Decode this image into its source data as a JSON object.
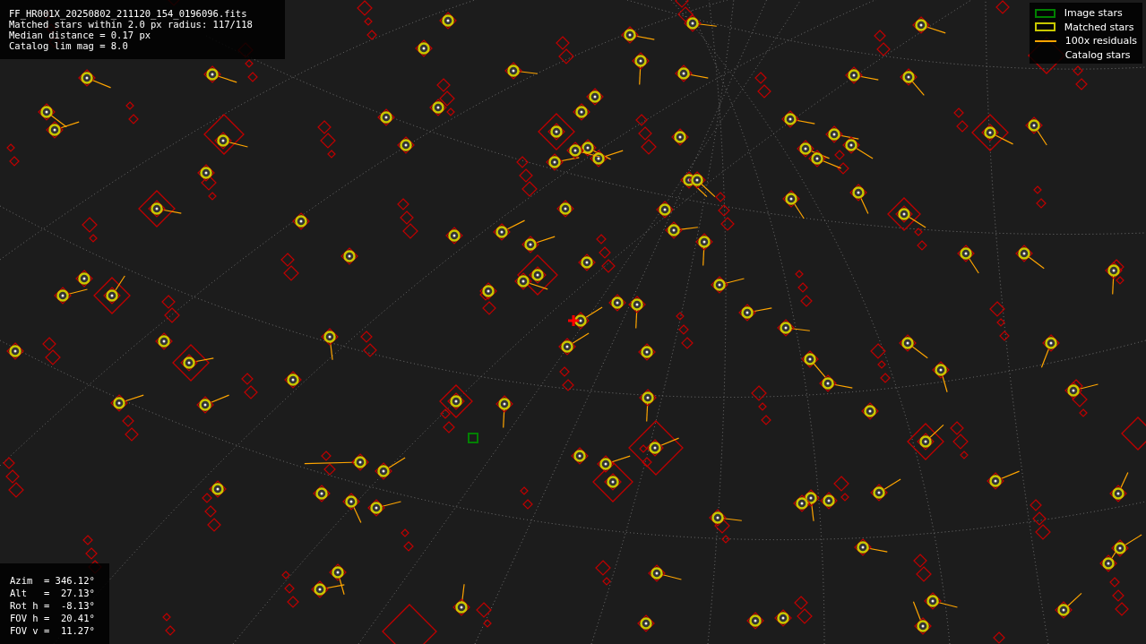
{
  "info": {
    "lines": [
      "FF_HR001X_20250802_211120_154_0196096.fits",
      "Matched stars within 2.0 px radius: 117/118",
      "Median distance = 0.17 px",
      "Catalog lim mag = 8.0"
    ]
  },
  "legend": [
    {
      "label": "Image stars",
      "kind": "box",
      "color": "#008000"
    },
    {
      "label": "Matched stars",
      "kind": "box",
      "color": "#c8c800"
    },
    {
      "label": "100x residuals",
      "kind": "line",
      "color": "#ffa500"
    },
    {
      "label": "Catalog stars",
      "kind": "none"
    }
  ],
  "pointing": {
    "lines": [
      "Azim  = 346.12°",
      "Alt   =  27.13°",
      "Rot h =  -8.13°",
      "FOV h =  20.41°",
      "FOV v =  11.27°"
    ]
  }
}
